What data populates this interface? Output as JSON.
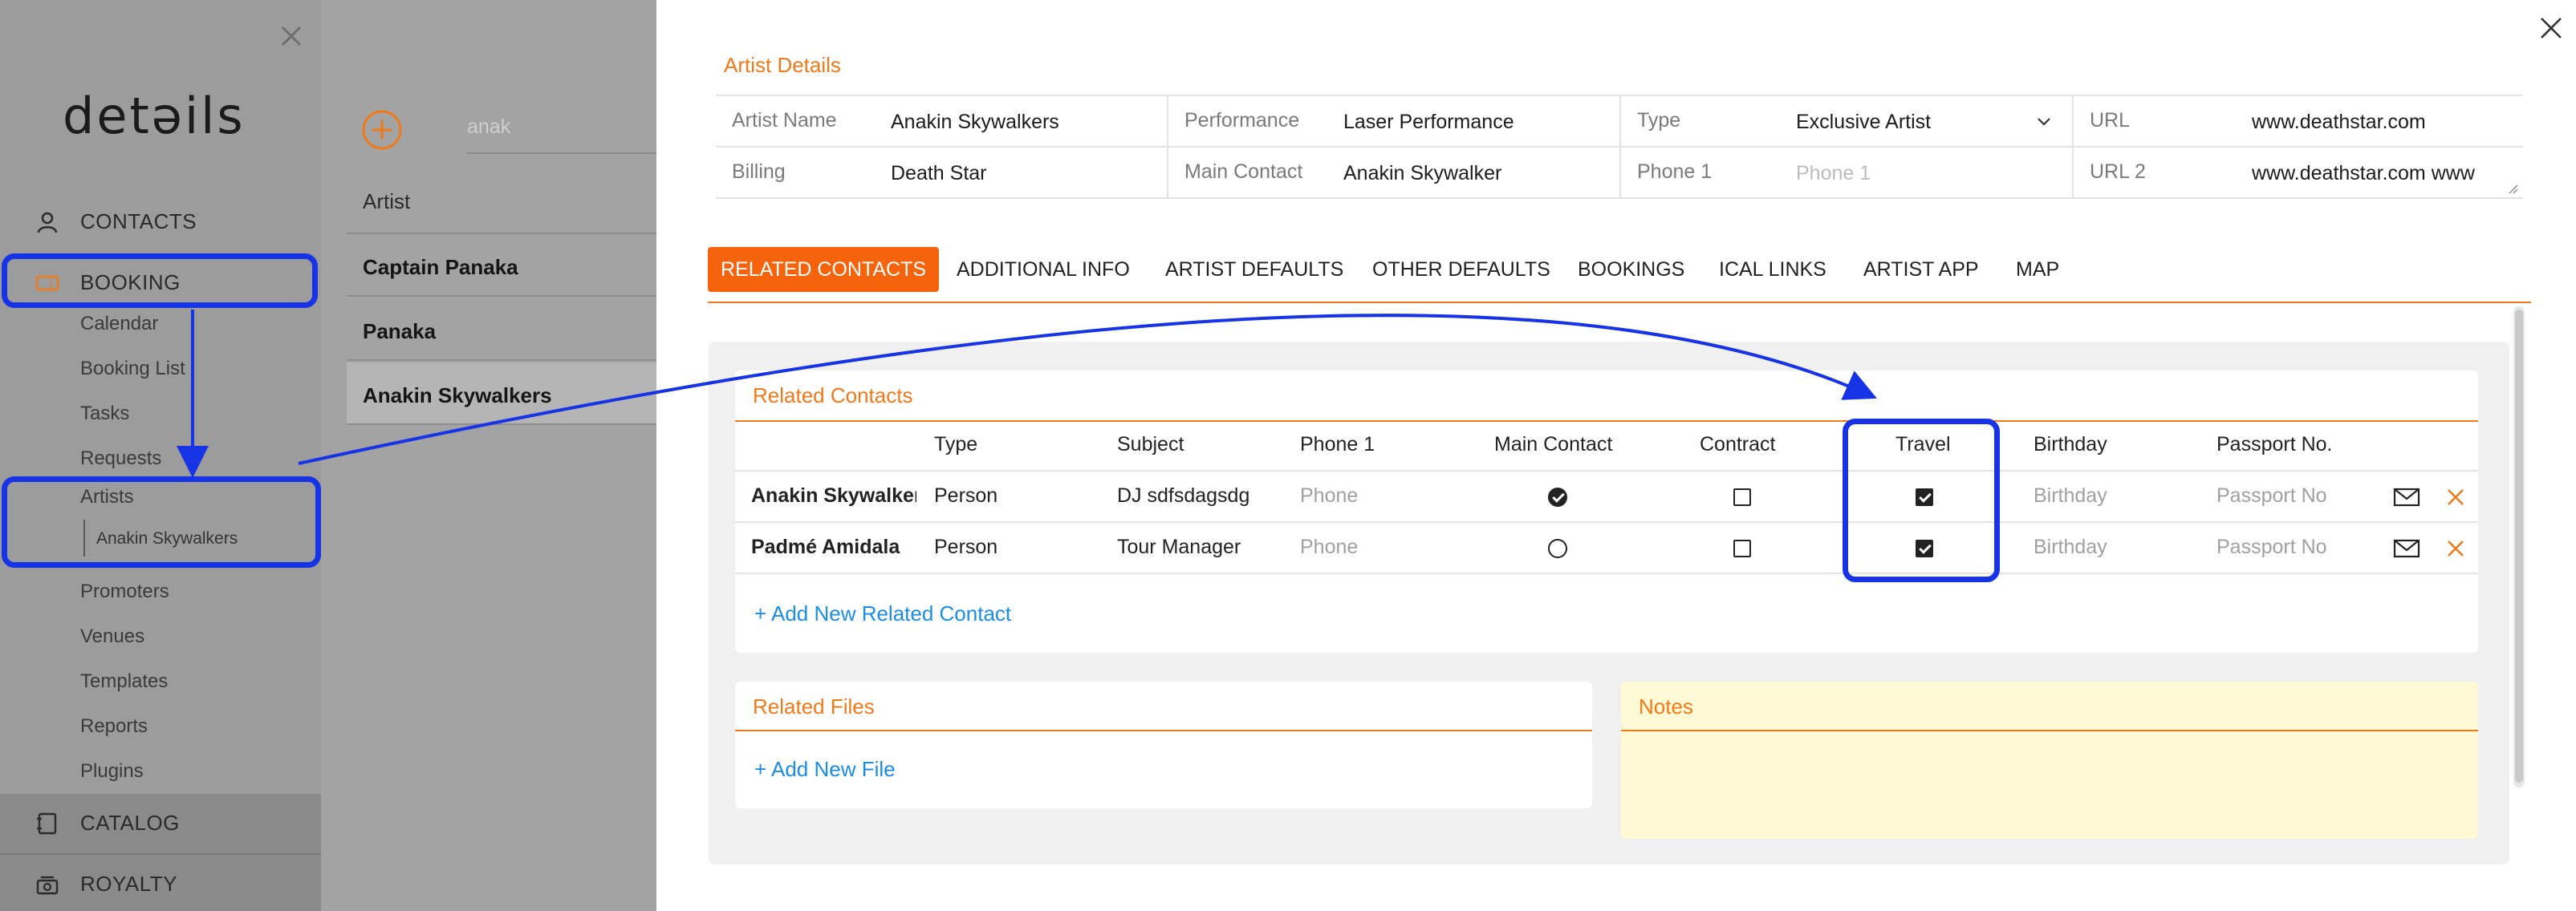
{
  "sidebar": {
    "logo": "detəils",
    "nav": {
      "contacts": "CONTACTS",
      "booking": "BOOKING",
      "catalog": "CATALOG",
      "royalty": "ROYALTY"
    },
    "booking_items": [
      "Calendar",
      "Booking List",
      "Tasks",
      "Requests",
      "Artists"
    ],
    "artists_child": "Anakin Skywalkers",
    "more_items": [
      "Promoters",
      "Venues",
      "Templates",
      "Reports",
      "Plugins"
    ]
  },
  "list": {
    "search_value": "anak",
    "column_header": "Artist",
    "rows": [
      "Captain Panaka",
      "Panaka",
      "Anakin Skywalkers"
    ]
  },
  "details": {
    "title": "Artist Details",
    "fields": {
      "artist_name_label": "Artist Name",
      "artist_name": "Anakin Skywalkers",
      "performance_label": "Performance",
      "performance": "Laser Performance",
      "type_label": "Type",
      "type": "Exclusive Artist",
      "url_label": "URL",
      "url": "www.deathstar.com",
      "billing_label": "Billing",
      "billing": "Death Star",
      "main_contact_label": "Main Contact",
      "main_contact": "Anakin Skywalker",
      "phone1_label": "Phone 1",
      "phone1_placeholder": "Phone 1",
      "url2_label": "URL 2",
      "url2": "www.deathstar.com www"
    },
    "tabs": [
      "RELATED CONTACTS",
      "ADDITIONAL INFO",
      "ARTIST DEFAULTS",
      "OTHER DEFAULTS",
      "BOOKINGS",
      "ICAL LINKS",
      "ARTIST APP",
      "MAP"
    ],
    "active_tab": "RELATED CONTACTS",
    "related_contacts": {
      "title": "Related Contacts",
      "columns": [
        "Type",
        "Subject",
        "Phone 1",
        "Main Contact",
        "Contract",
        "Travel",
        "Birthday",
        "Passport No."
      ],
      "rows": [
        {
          "name": "Anakin Skywalker",
          "type": "Person",
          "subject": "DJ sdfsdagsdg",
          "phone": "Phone",
          "main_contact": true,
          "contract": false,
          "travel": true,
          "birthday": "Birthday",
          "passport": "Passport No"
        },
        {
          "name": "Padmé Amidala",
          "type": "Person",
          "subject": "Tour Manager",
          "phone": "Phone",
          "main_contact": false,
          "contract": false,
          "travel": true,
          "birthday": "Birthday",
          "passport": "Passport No"
        }
      ],
      "add_link": "+ Add New Related Contact"
    },
    "related_files": {
      "title": "Related Files",
      "add_link": "+ Add New File"
    },
    "notes": {
      "title": "Notes"
    }
  },
  "colors": {
    "accent": "#f5640c",
    "highlight": "#1633e6",
    "link": "#1a8ee6",
    "notes_bg": "#fff9d6"
  }
}
